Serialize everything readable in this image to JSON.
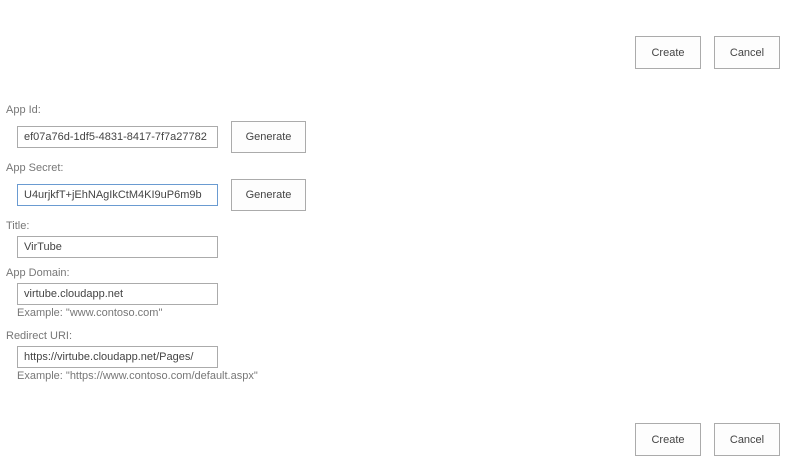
{
  "toolbar_top": {
    "create_label": "Create",
    "cancel_label": "Cancel"
  },
  "toolbar_bottom": {
    "create_label": "Create",
    "cancel_label": "Cancel"
  },
  "form": {
    "app_id": {
      "label": "App Id:",
      "value": "ef07a76d-1df5-4831-8417-7f7a27782",
      "generate_label": "Generate"
    },
    "app_secret": {
      "label": "App Secret:",
      "value": "U4urjkfT+jEhNAgIkCtM4KI9uP6m9b",
      "generate_label": "Generate"
    },
    "title": {
      "label": "Title:",
      "value": "VirTube"
    },
    "app_domain": {
      "label": "App Domain:",
      "value": "virtube.cloudapp.net",
      "example": "Example: \"www.contoso.com\""
    },
    "redirect_uri": {
      "label": "Redirect URI:",
      "value": "https://virtube.cloudapp.net/Pages/",
      "example": "Example: \"https://www.contoso.com/default.aspx\""
    }
  }
}
